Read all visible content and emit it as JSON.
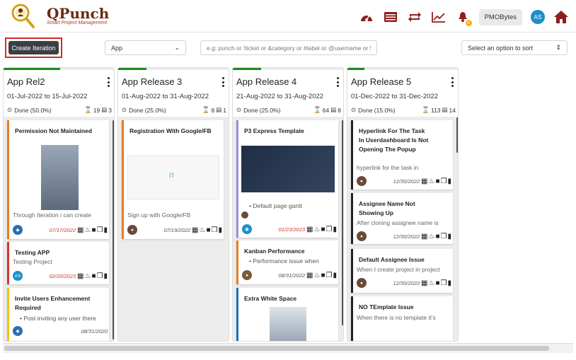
{
  "app": {
    "logo_text": "QPunch",
    "logo_sub": "Smart Project Management",
    "org_name": "PMOBytes",
    "user_initials": "AS",
    "notif_count": "0"
  },
  "toolbar": {
    "create_label": "Create Iteration",
    "project_select": "App",
    "search_placeholder": "e.g: punch or !ticket or &category or #label or @username or $priority",
    "sort_placeholder": "Select an option to sort"
  },
  "columns": [
    {
      "title": "App Rel2",
      "dates": "01-Jul-2022 to 15-Jul-2022",
      "status": "Done (50.0%)",
      "count_a": "19",
      "count_b": "3",
      "cards": [
        {
          "title": "Permission Not Maintained",
          "desc": "Through Iteration i can create",
          "date": "07/17/2022",
          "overdue": true,
          "accent": "#e67e22"
        },
        {
          "title": "Testing APP",
          "desc": "Testing Project",
          "date": "02/20/2023",
          "overdue": true,
          "accent": "#d9342b"
        },
        {
          "title": "Invite Users Enhancement Required",
          "bullet": "Post inviting any user there",
          "date": "08/31/2020",
          "overdue": true,
          "accent": "#f1c40f"
        }
      ]
    },
    {
      "title": "App Release 3",
      "dates": "01-Aug-2022 to 31-Aug-2022",
      "status": "Done (25.0%)",
      "count_a": "8",
      "count_b": "1",
      "cards": [
        {
          "title": "Registration With Google/FB",
          "desc": "Sign up with Google/FB",
          "date": "07/19/2022",
          "overdue": false,
          "accent": "#e67e22"
        }
      ]
    },
    {
      "title": "App Release 4",
      "dates": "21-Aug-2022 to 31-Aug-2022",
      "status": "Done (25.0%)",
      "count_a": "64",
      "count_b": "8",
      "cards": [
        {
          "title": "P3 Express Template",
          "bullet": "Default page gantt",
          "date": "01/23/2023",
          "overdue": true,
          "accent": "#9b8fd6"
        },
        {
          "title": "Kanban Performance",
          "bullet": "Performance issue when",
          "date": "08/31/2022",
          "overdue": false,
          "accent": "#e67e22"
        },
        {
          "title": "Extra White Space",
          "accent": "#1d6fb8"
        }
      ]
    },
    {
      "title": "App Release 5",
      "dates": "01-Dec-2022 to 31-Dec-2022",
      "status": "Done (15.0%)",
      "count_a": "113",
      "count_b": "14",
      "cards": [
        {
          "title": "Hyperlink For The Task In Userdashboard Is Not Opening The Popup",
          "desc": "hyperlink for the task in",
          "date": "12/30/2022",
          "overdue": false,
          "accent": "#222222"
        },
        {
          "title": "Assignee Name Not Showing Up",
          "desc": "After cloning assignee name is",
          "date": "12/30/2022",
          "overdue": false,
          "accent": "#222222"
        },
        {
          "title": "Default Assignee Issue",
          "desc": "When I create project in project",
          "date": "12/30/2022",
          "overdue": false,
          "accent": "#222222"
        },
        {
          "title": "NO TEmplate Issue",
          "desc": "When there is no template it's",
          "accent": "#222222"
        }
      ]
    }
  ],
  "image_text": {
    "google_fb": "I'I"
  }
}
